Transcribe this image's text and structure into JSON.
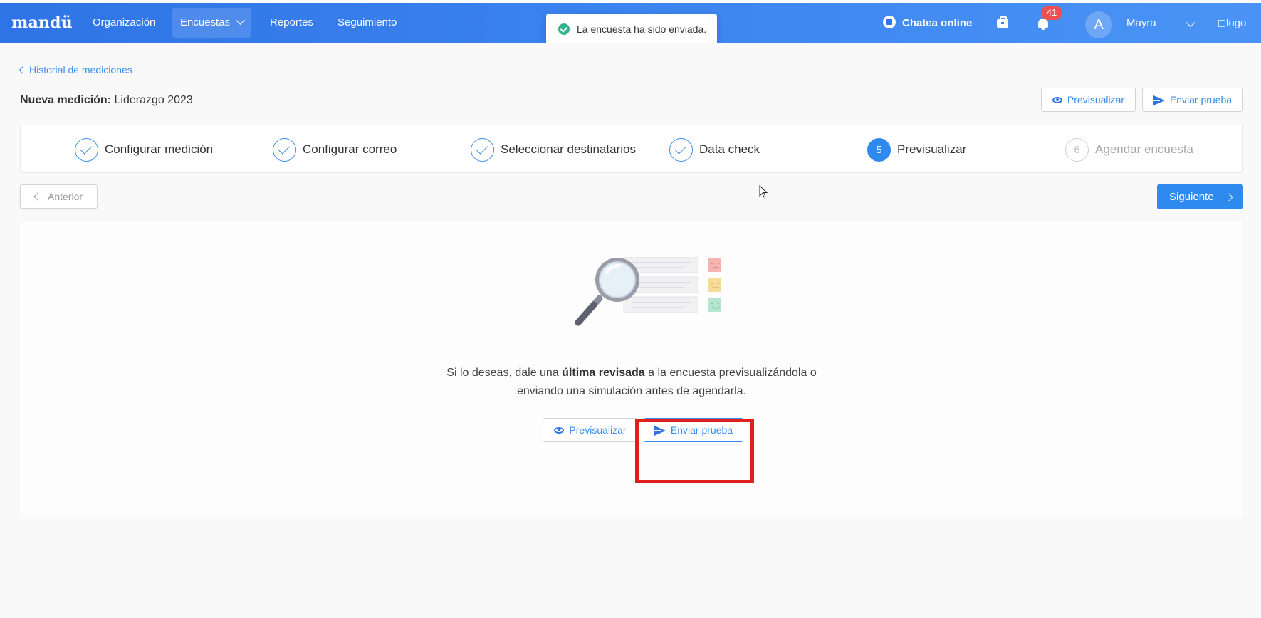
{
  "brand": "mandü",
  "nav": {
    "items": [
      {
        "label": "Organización"
      },
      {
        "label": "Encuestas"
      },
      {
        "label": "Reportes"
      },
      {
        "label": "Seguimiento"
      }
    ],
    "active_index": 1
  },
  "header": {
    "chat_label": "Chatea online",
    "notifications_count": "41",
    "avatar_letter": "A",
    "user_name": "Mayra",
    "logo_alt": "logo"
  },
  "toast": {
    "message": "La encuesta ha sido enviada."
  },
  "breadcrumb": {
    "back_label": "Historial de mediciones"
  },
  "page": {
    "title_prefix": "Nueva medición:",
    "title_value": "Liderazgo 2023",
    "preview_button": "Previsualizar",
    "send_test_button": "Enviar prueba"
  },
  "stepper": {
    "steps": [
      {
        "label": "Configurar medición",
        "state": "done"
      },
      {
        "label": "Configurar correo",
        "state": "done"
      },
      {
        "label": "Seleccionar destinatarios",
        "state": "done"
      },
      {
        "label": "Data check",
        "state": "done"
      },
      {
        "label": "Previsualizar",
        "state": "current",
        "number": "5"
      },
      {
        "label": "Agendar encuesta",
        "state": "pending",
        "number": "6"
      }
    ]
  },
  "navigation": {
    "previous_label": "Anterior",
    "next_label": "Siguiente"
  },
  "main": {
    "message_part1": "Si lo deseas, dale una ",
    "message_bold": "última revisada",
    "message_part2": " a la encuesta previsualizándola o enviando una simulación antes de agendarla.",
    "preview_button": "Previsualizar",
    "send_test_button": "Enviar prueba"
  },
  "colors": {
    "primary": "#2f8af0",
    "nav_gradient_start": "#2f74e6",
    "nav_gradient_end": "#4a93f6",
    "success": "#34b38a",
    "badge": "#f05050",
    "highlight": "#e0201f"
  }
}
